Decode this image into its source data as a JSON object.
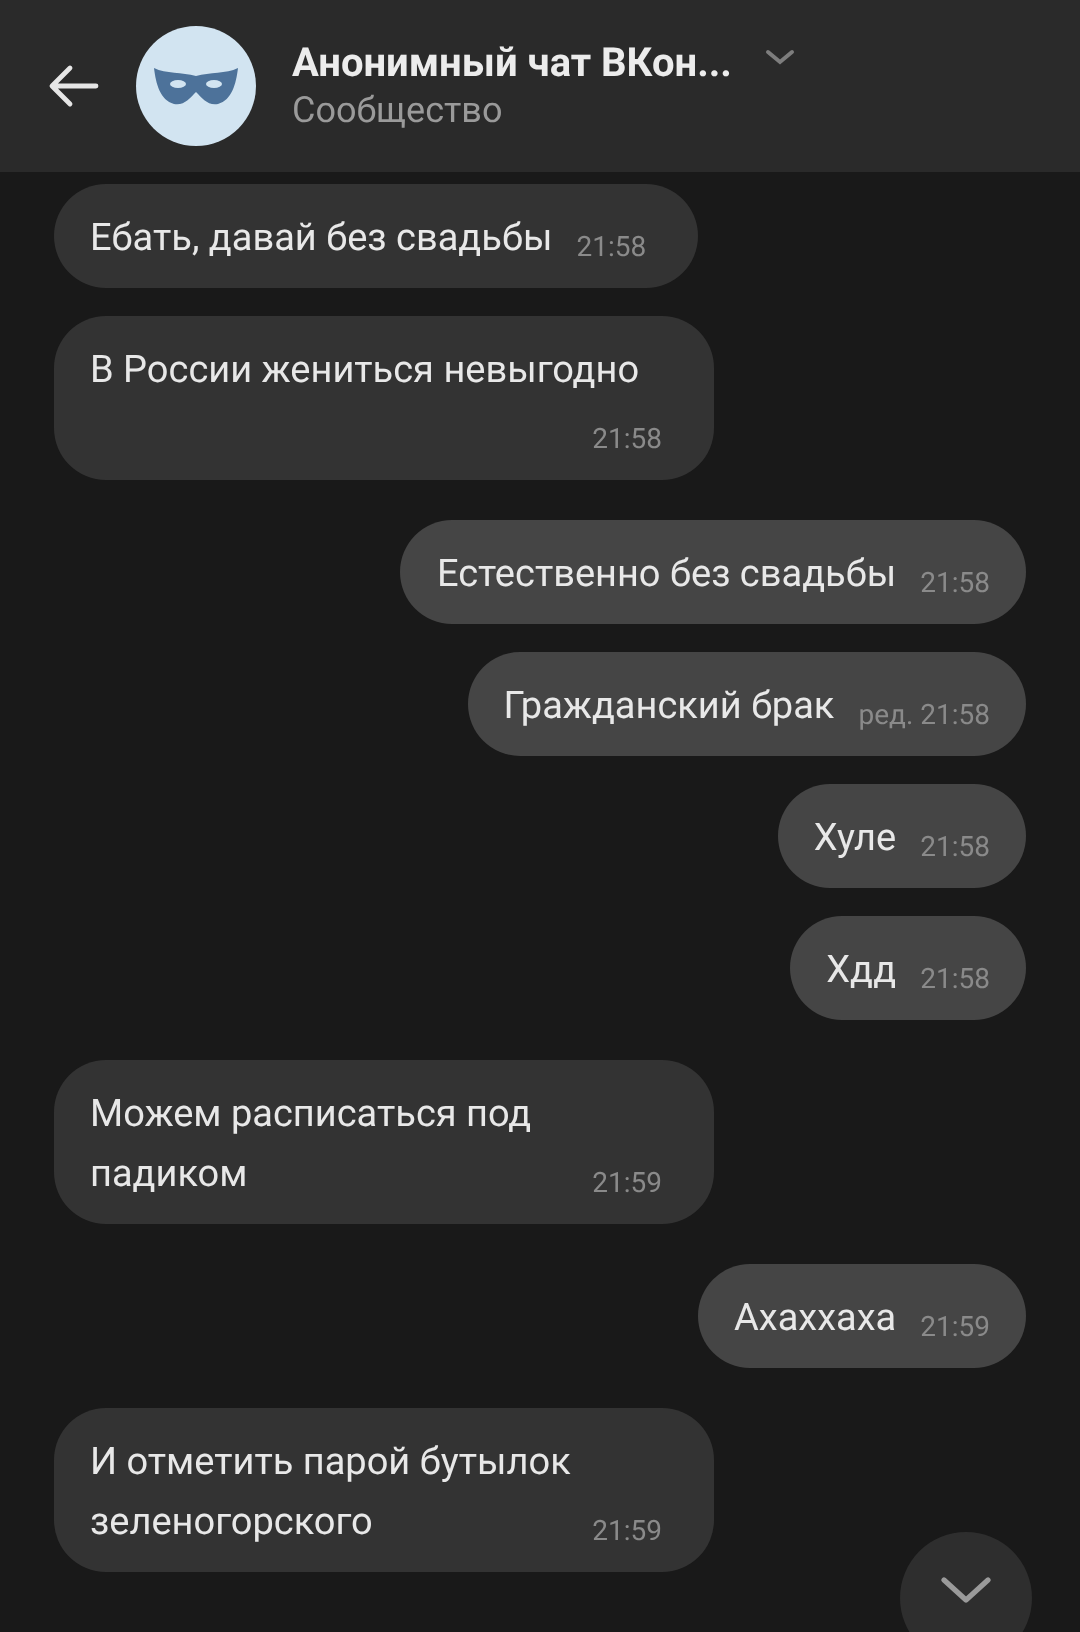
{
  "header": {
    "title": "Анонимный чат ВКон...",
    "subtitle": "Сообщество"
  },
  "messages": [
    {
      "outgoing": false,
      "text": "Ебать, давай без свадьбы",
      "time": "21:58"
    },
    {
      "outgoing": false,
      "text": "В России жениться невыгодно",
      "time": "21:58"
    },
    {
      "outgoing": true,
      "text": "Естественно без свадьбы",
      "time": "21:58"
    },
    {
      "outgoing": true,
      "text": "Гражданский брак",
      "edited": "ред.",
      "time": "21:58"
    },
    {
      "outgoing": true,
      "text": "Хуле",
      "time": "21:58"
    },
    {
      "outgoing": true,
      "text": "Хдд",
      "time": "21:58"
    },
    {
      "outgoing": false,
      "text": "Можем расписаться под падиком",
      "time": "21:59"
    },
    {
      "outgoing": true,
      "text": "Ахаххаха",
      "time": "21:59"
    },
    {
      "outgoing": false,
      "text": "И отметить парой бутылок зеленогорского",
      "time": "21:59"
    }
  ]
}
